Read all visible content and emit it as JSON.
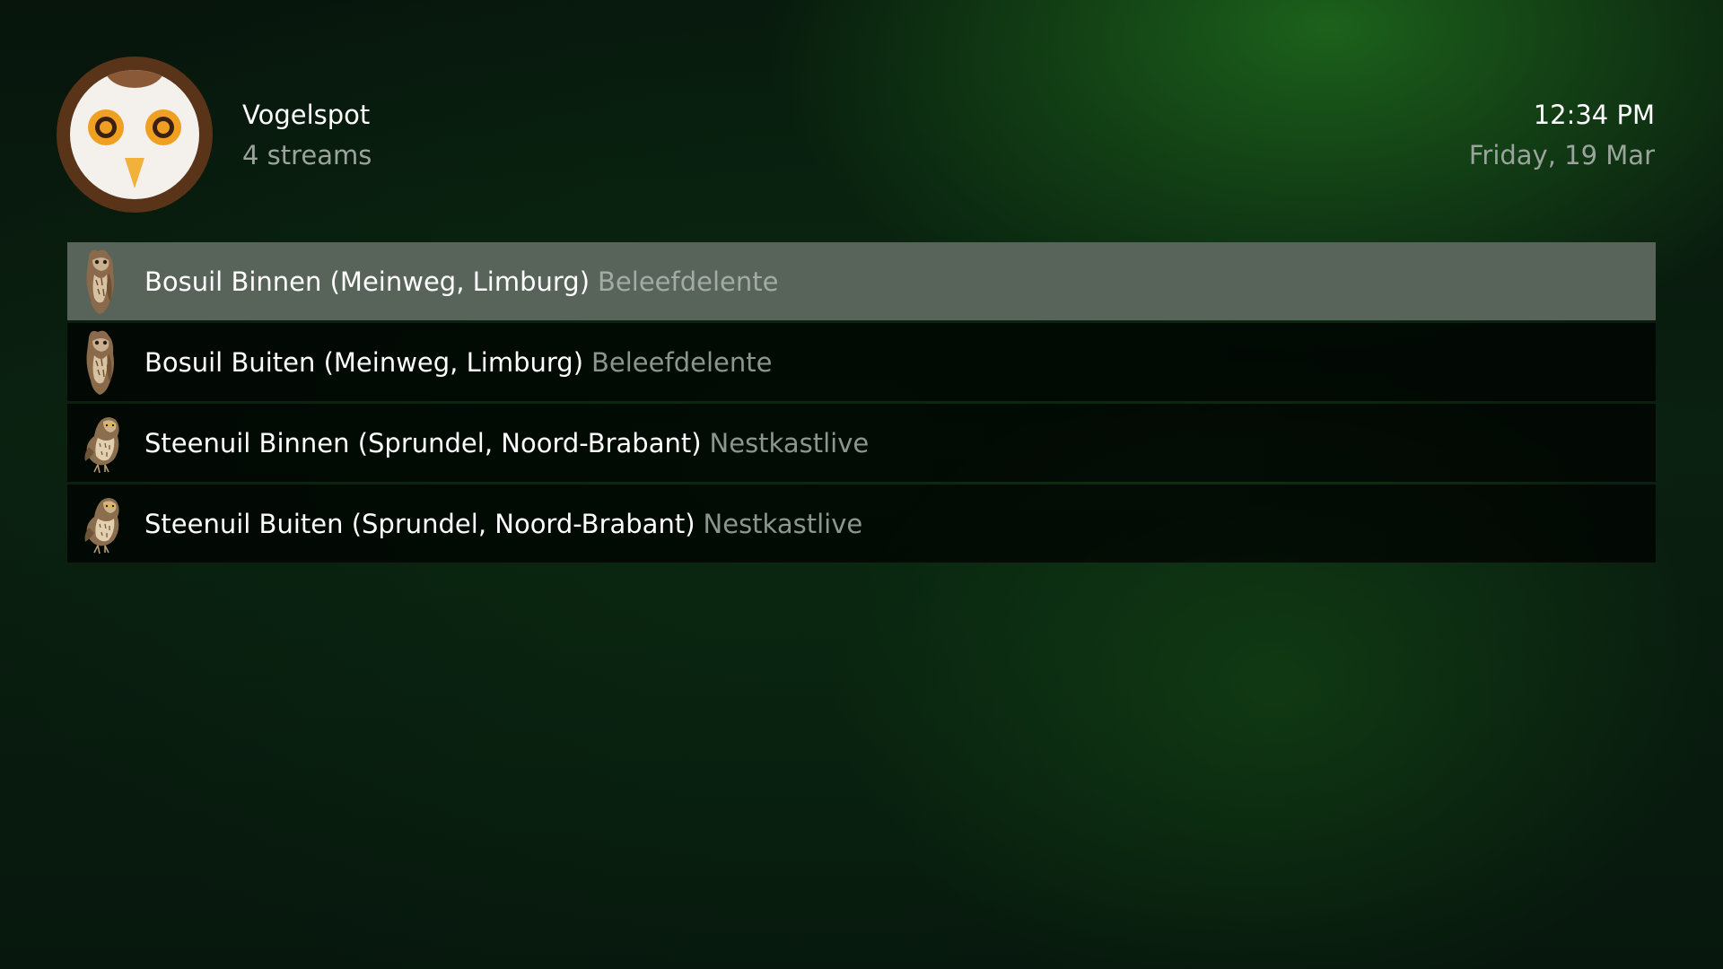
{
  "header": {
    "app_title": "Vogelspot",
    "subtitle": "4 streams",
    "logo_icon": "owl-logo-icon"
  },
  "status": {
    "time": "12:34 PM",
    "date": "Friday, 19 Mar"
  },
  "streams": [
    {
      "label": "Bosuil Binnen (Meinweg, Limburg)",
      "source": "Beleefdelente",
      "icon": "tawny-owl-icon",
      "selected": true
    },
    {
      "label": "Bosuil Buiten (Meinweg, Limburg)",
      "source": "Beleefdelente",
      "icon": "tawny-owl-icon",
      "selected": false
    },
    {
      "label": "Steenuil Binnen (Sprundel, Noord-Brabant)",
      "source": "Nestkastlive",
      "icon": "little-owl-icon",
      "selected": false
    },
    {
      "label": "Steenuil Buiten (Sprundel, Noord-Brabant)",
      "source": "Nestkastlive",
      "icon": "little-owl-icon",
      "selected": false
    }
  ],
  "colors": {
    "accent_green": "#1e6e1e",
    "selected_row": "#58645a",
    "secondary_text": "#9aa49c"
  }
}
